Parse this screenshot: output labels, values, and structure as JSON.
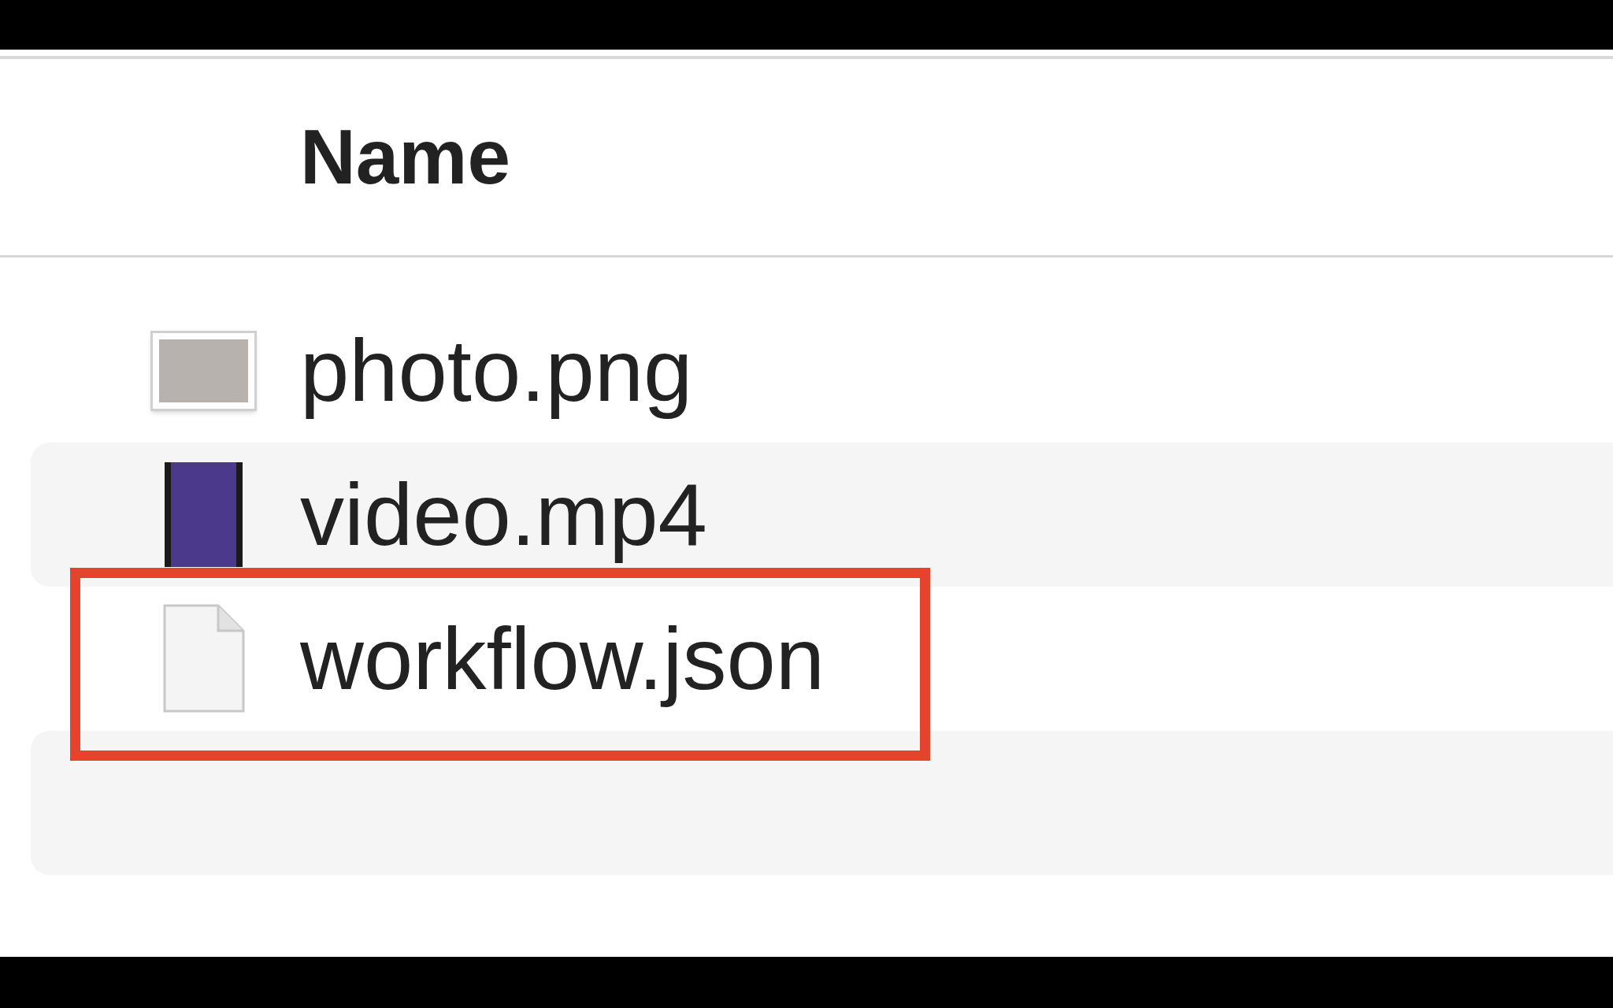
{
  "columns": [
    {
      "label": "Name"
    }
  ],
  "rows": [
    {
      "name": "photo.png",
      "kind": "image",
      "highlighted": false
    },
    {
      "name": "video.mp4",
      "kind": "video",
      "highlighted": false
    },
    {
      "name": "workflow.json",
      "kind": "document",
      "highlighted": true
    },
    {
      "kind": "empty",
      "highlighted": false
    }
  ]
}
